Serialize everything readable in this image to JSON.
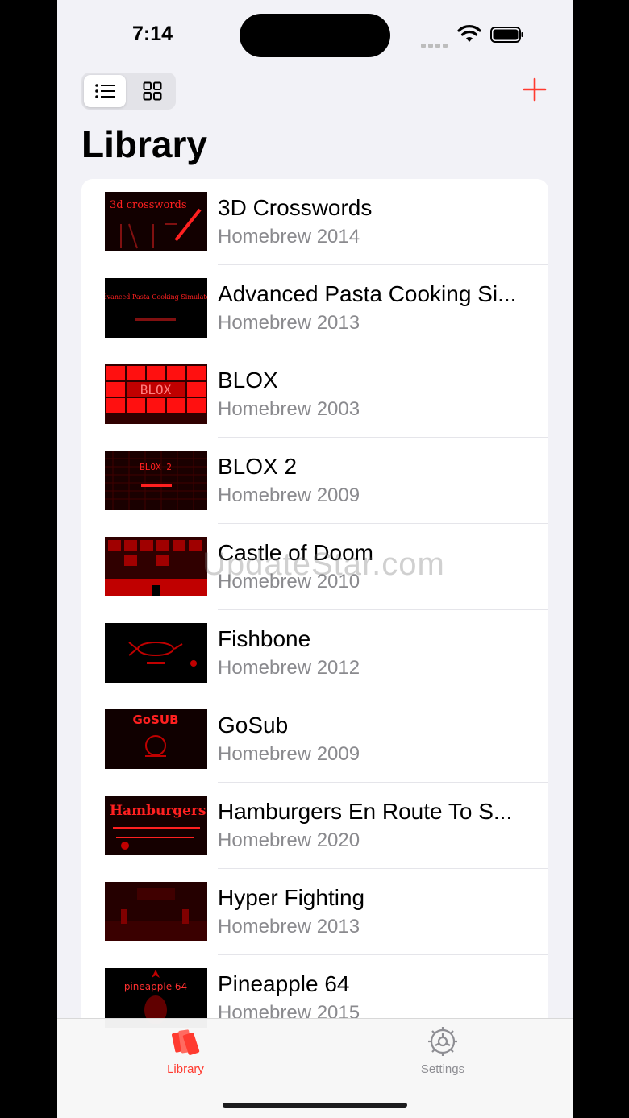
{
  "status": {
    "time": "7:14"
  },
  "header": {
    "title": "Library"
  },
  "view_toggle": {
    "list_icon": "list-icon",
    "grid_icon": "grid-icon",
    "selected": "list"
  },
  "add_icon": "plus-icon",
  "accent": "#ff3b30",
  "games": [
    {
      "title": "3D Crosswords",
      "subtitle": "Homebrew 2014",
      "thumb_text": "3d crosswords"
    },
    {
      "title": "Advanced Pasta Cooking Si...",
      "subtitle": "Homebrew 2013",
      "thumb_text": "Advanced Pasta Cooking Simulator"
    },
    {
      "title": "BLOX",
      "subtitle": "Homebrew 2003",
      "thumb_text": "BLOX"
    },
    {
      "title": "BLOX 2",
      "subtitle": "Homebrew 2009",
      "thumb_text": "BLOX 2"
    },
    {
      "title": "Castle of Doom",
      "subtitle": "Homebrew 2010",
      "thumb_text": ""
    },
    {
      "title": "Fishbone",
      "subtitle": "Homebrew 2012",
      "thumb_text": ""
    },
    {
      "title": "GoSub",
      "subtitle": "Homebrew 2009",
      "thumb_text": "GoSUB"
    },
    {
      "title": "Hamburgers En Route To S...",
      "subtitle": "Homebrew 2020",
      "thumb_text": "Hamburgers"
    },
    {
      "title": "Hyper Fighting",
      "subtitle": "Homebrew 2013",
      "thumb_text": ""
    },
    {
      "title": "Pineapple 64",
      "subtitle": "Homebrew 2015",
      "thumb_text": "pineapple 64"
    }
  ],
  "watermark": "UpdateStar.com",
  "tabbar": {
    "library": {
      "label": "Library",
      "icon": "library-icon",
      "selected": true
    },
    "settings": {
      "label": "Settings",
      "icon": "gear-icon",
      "selected": false
    }
  }
}
